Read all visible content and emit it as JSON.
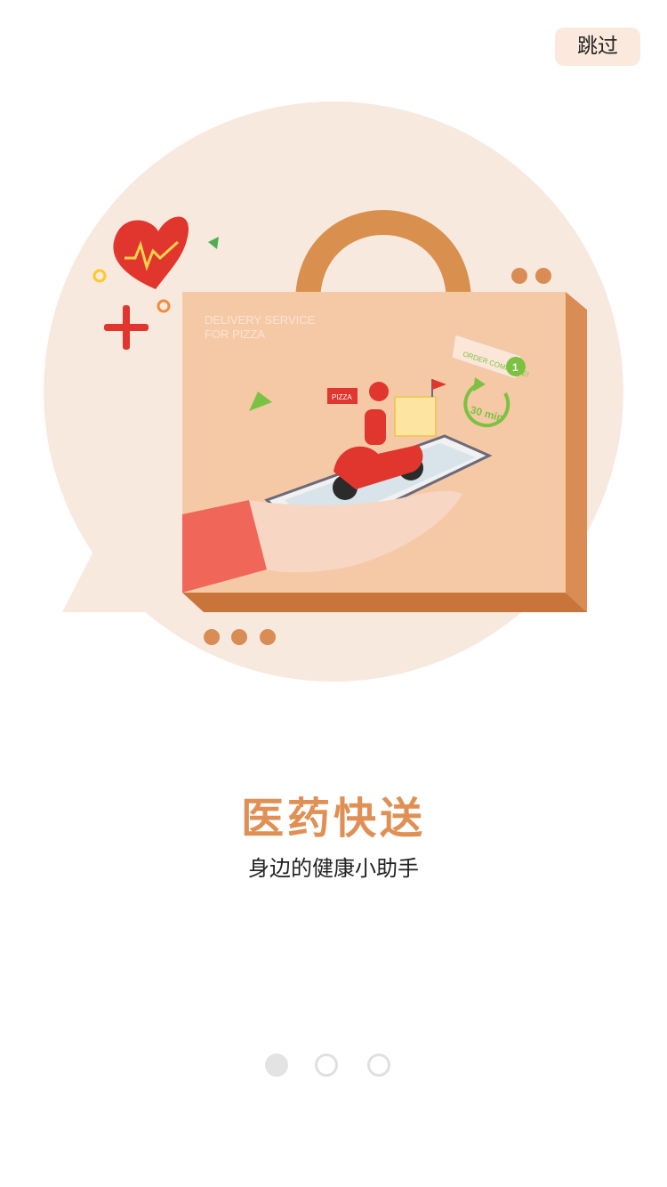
{
  "header": {
    "skip_label": "跳过"
  },
  "illustration": {
    "box_text_line1": "DELIVERY SERVICE",
    "box_text_line2": "FOR PIZZA",
    "order_tag": "ORDER COMPLETE!",
    "order_number": "1",
    "timer_label": "30 min",
    "pizza_box_label": "PIZZA",
    "colors": {
      "bubble": "#f8e9df",
      "box_face": "#f6c9a6",
      "box_side": "#d98c54",
      "handle": "#d9904f",
      "accent_red": "#e0362e",
      "accent_green": "#7cc242",
      "dots": "#d98c54"
    }
  },
  "content": {
    "title": "医药快送",
    "subtitle": "身边的健康小助手"
  },
  "pager": {
    "total": 3,
    "active_index": 0
  },
  "theme": {
    "title_color": "#e09055",
    "skip_bg": "#fbe9dd"
  }
}
